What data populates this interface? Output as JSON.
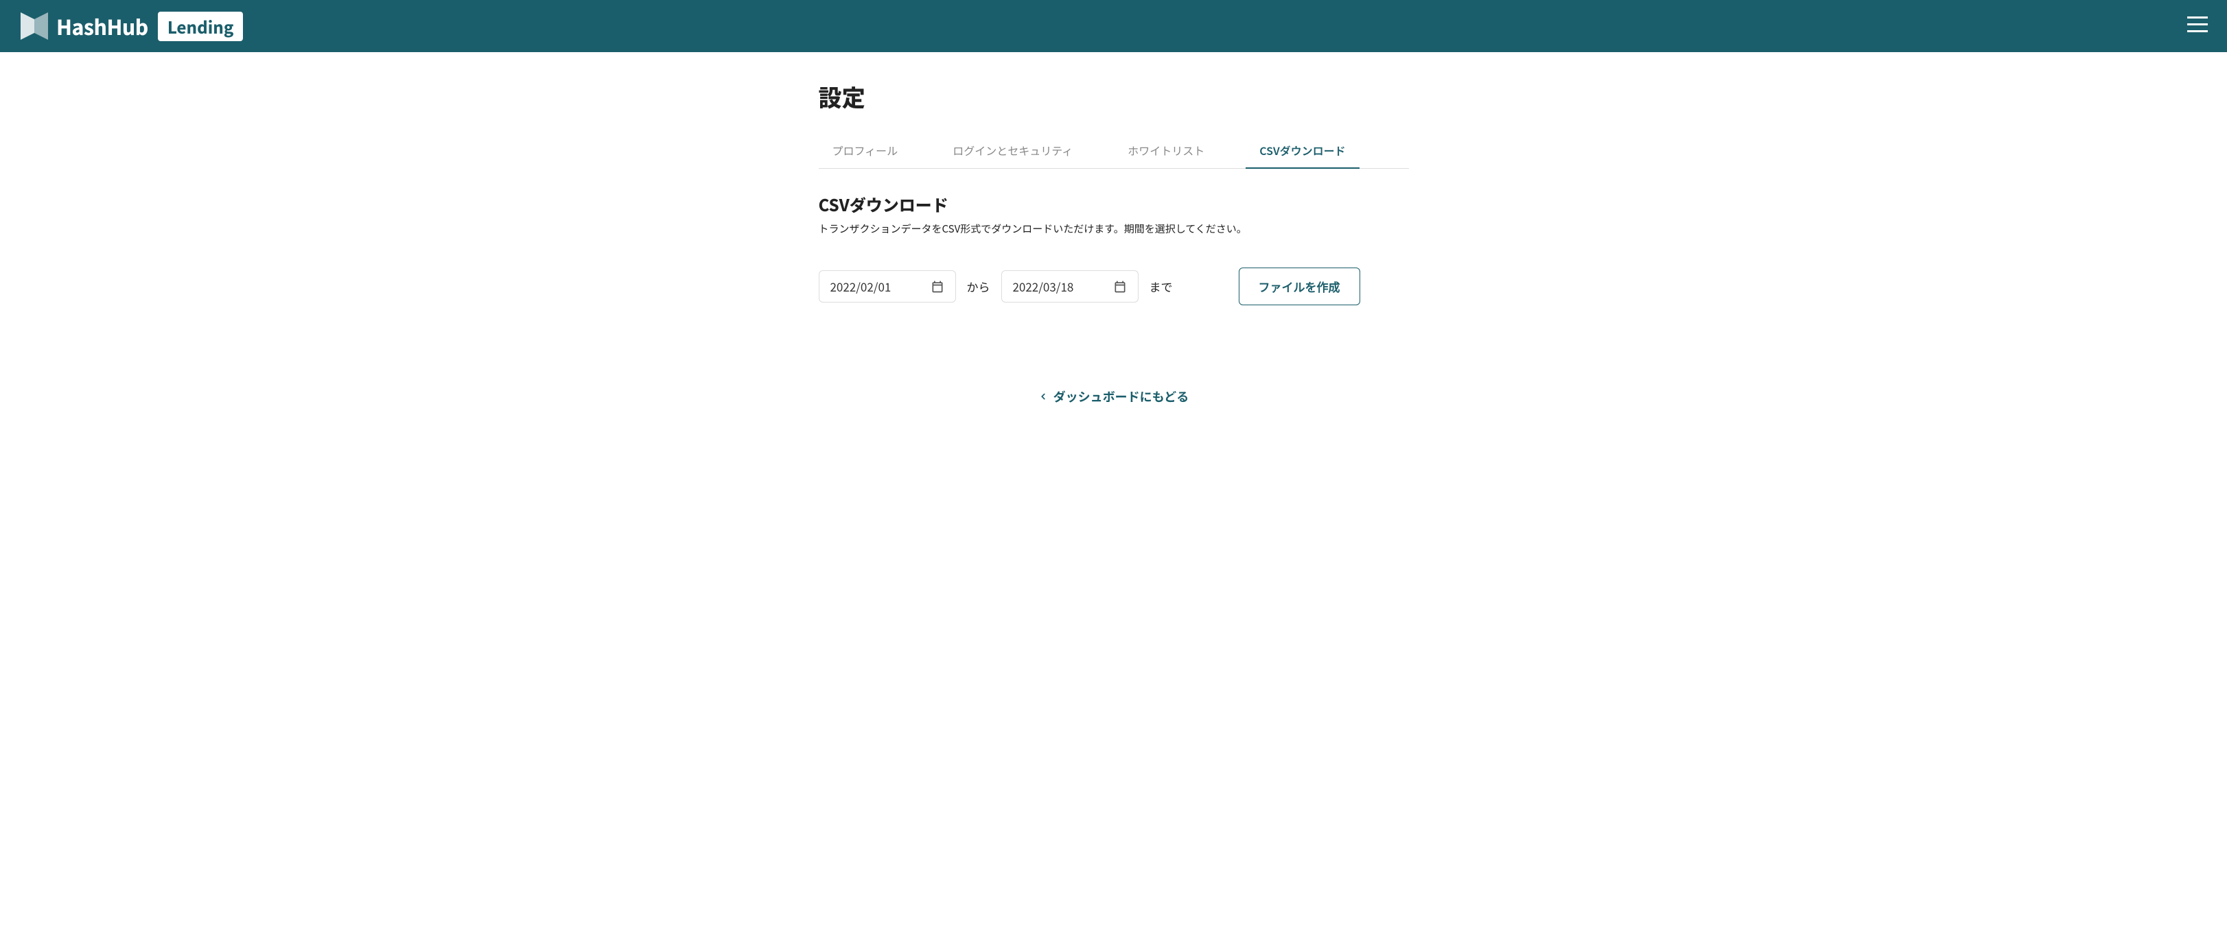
{
  "header": {
    "brand_name": "HashHub",
    "brand_badge": "Lending"
  },
  "page": {
    "title": "設定"
  },
  "tabs": [
    {
      "id": "profile",
      "label": "プロフィール",
      "active": false
    },
    {
      "id": "security",
      "label": "ログインとセキュリティ",
      "active": false
    },
    {
      "id": "whitelist",
      "label": "ホワイトリスト",
      "active": false
    },
    {
      "id": "csv",
      "label": "CSVダウンロード",
      "active": true
    }
  ],
  "csv": {
    "heading": "CSVダウンロード",
    "description": "トランザクションデータをCSV形式でダウンロードいただけます。期間を選択してください。",
    "date_from": "2022/02/01",
    "from_label": "から",
    "date_to": "2022/03/18",
    "to_label": "まで",
    "create_button": "ファイルを作成"
  },
  "back": {
    "label": "ダッシュボードにもどる"
  },
  "colors": {
    "brand": "#1b5e6b",
    "annotation": "#ff0000"
  }
}
